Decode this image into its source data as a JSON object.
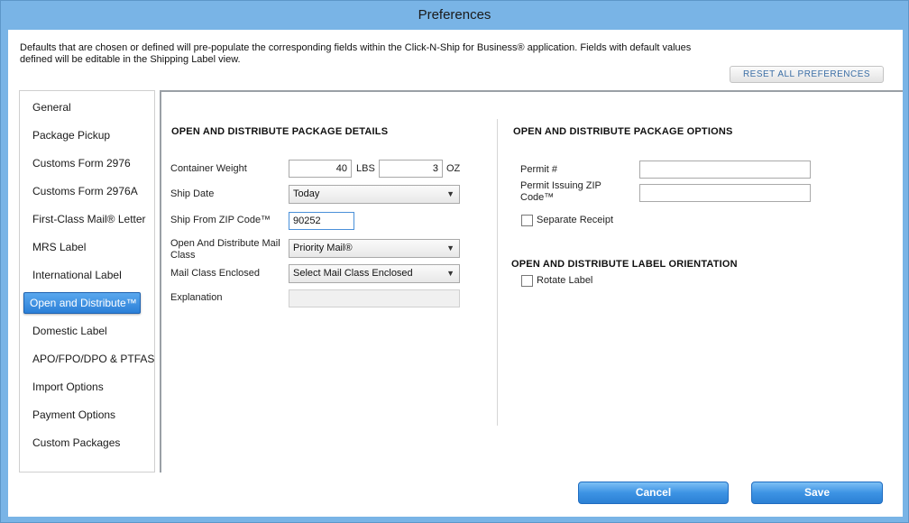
{
  "window": {
    "title": "Preferences"
  },
  "intro": {
    "line1": "Defaults that are chosen or defined will pre-populate the corresponding fields within the Click-N-Ship for Business® application.  Fields with default values",
    "line2": "defined will be editable in the Shipping Label view."
  },
  "reset_button": "RESET ALL PREFERENCES",
  "sidebar": {
    "items": [
      {
        "label": "General"
      },
      {
        "label": "Package Pickup"
      },
      {
        "label": "Customs Form 2976"
      },
      {
        "label": "Customs Form 2976A"
      },
      {
        "label": "First-Class Mail® Letter"
      },
      {
        "label": "MRS Label"
      },
      {
        "label": "International Label"
      },
      {
        "label": "Open and Distribute™"
      },
      {
        "label": "Domestic Label"
      },
      {
        "label": "APO/FPO/DPO & PTFAS"
      },
      {
        "label": "Import Options"
      },
      {
        "label": "Payment Options"
      },
      {
        "label": "Custom Packages"
      }
    ],
    "active_index": 7
  },
  "details": {
    "title": "OPEN AND DISTRIBUTE PACKAGE DETAILS",
    "container_weight_label": "Container Weight",
    "weight_lbs_value": "40",
    "weight_lbs_unit": "LBS",
    "weight_oz_value": "3",
    "weight_oz_unit": "OZ",
    "ship_date_label": "Ship Date",
    "ship_date_value": "Today",
    "ship_from_zip_label": "Ship From ZIP Code™",
    "ship_from_zip_value": "90252",
    "mail_class_label_line1": "Open And Distribute Mail",
    "mail_class_label_line2": "Class",
    "mail_class_value": "Priority Mail®",
    "mail_class_enclosed_label": "Mail Class Enclosed",
    "mail_class_enclosed_value": "Select Mail Class Enclosed",
    "explanation_label": "Explanation",
    "explanation_value": ""
  },
  "options": {
    "title": "OPEN AND DISTRIBUTE PACKAGE OPTIONS",
    "permit_label": "Permit #",
    "permit_value": "",
    "permit_zip_label_line1": "Permit Issuing ZIP",
    "permit_zip_label_line2": "Code™",
    "permit_zip_value": "",
    "separate_receipt_label": "Separate Receipt",
    "separate_receipt_checked": false
  },
  "orientation": {
    "title": "OPEN AND DISTRIBUTE LABEL ORIENTATION",
    "rotate_label": "Rotate Label",
    "rotate_checked": false
  },
  "footer": {
    "cancel_label": "Cancel",
    "save_label": "Save"
  },
  "colors": {
    "accent": "#2b80d4",
    "link": "#3b6ea5",
    "frame": "#79b4e6"
  }
}
